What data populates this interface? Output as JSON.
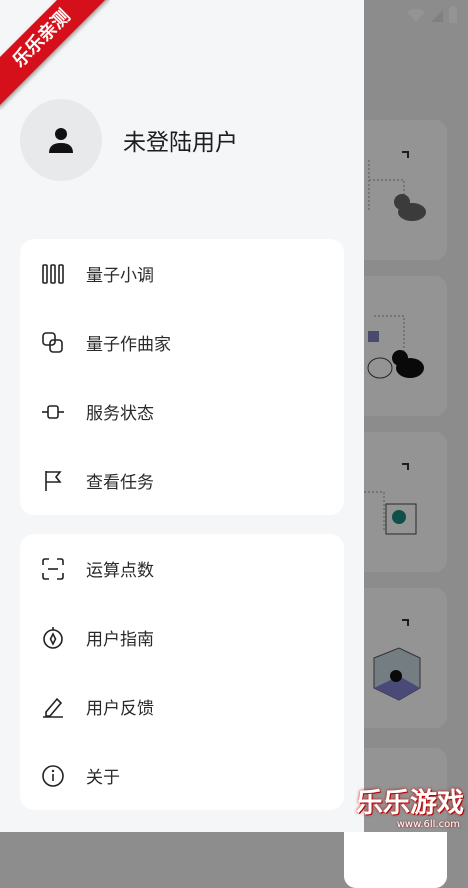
{
  "profile": {
    "name": "未登陆用户"
  },
  "menu_group_1": [
    {
      "label": "量子小调",
      "icon": "bars-icon"
    },
    {
      "label": "量子作曲家",
      "icon": "overlap-squares-icon"
    },
    {
      "label": "服务状态",
      "icon": "status-node-icon"
    },
    {
      "label": "查看任务",
      "icon": "flag-icon"
    }
  ],
  "menu_group_2": [
    {
      "label": "运算点数",
      "icon": "scan-icon"
    },
    {
      "label": "用户指南",
      "icon": "compass-icon"
    },
    {
      "label": "用户反馈",
      "icon": "pencil-icon"
    },
    {
      "label": "关于",
      "icon": "info-icon"
    }
  ],
  "ribbon": {
    "text": "乐乐亲测"
  },
  "watermark": {
    "text": "乐乐游戏",
    "url": "www.6ll.com"
  },
  "colors": {
    "ribbon": "#d6101a",
    "drawer_bg": "#f5f6f8",
    "card_bg": "#ffffff",
    "text": "#2a2a2a"
  }
}
